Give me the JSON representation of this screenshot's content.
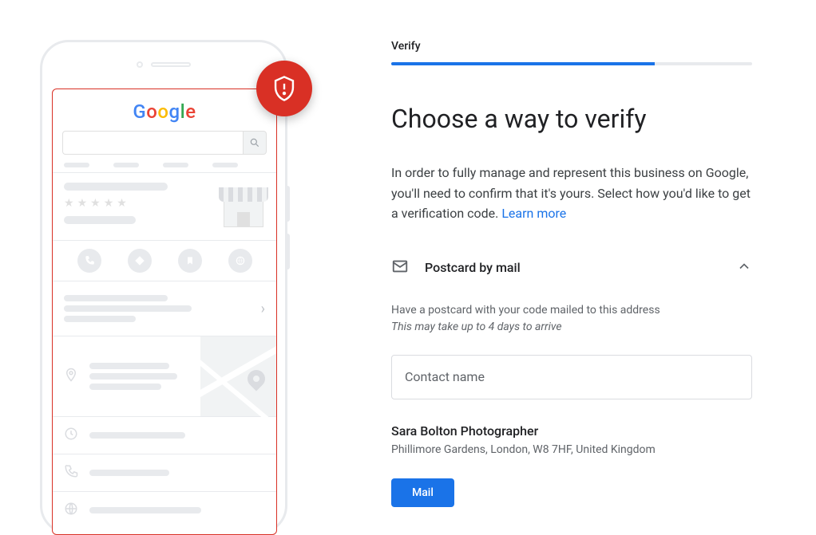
{
  "step_label": "Verify",
  "heading": "Choose a way to verify",
  "description": "In order to fully manage and represent this business on Google, you'll need to confirm that it's yours. Select how you'd like to get a verification code. ",
  "learn_more": "Learn more",
  "option": {
    "title": "Postcard by mail",
    "helper1": "Have a postcard with your code mailed to this address",
    "helper2": "This may take up to 4 days to arrive"
  },
  "input": {
    "placeholder": "Contact name",
    "value": ""
  },
  "business": {
    "name": "Sara Bolton Photographer",
    "address": "Phillimore Gardens, London, W8 7HF, United Kingdom"
  },
  "mail_button": "Mail"
}
